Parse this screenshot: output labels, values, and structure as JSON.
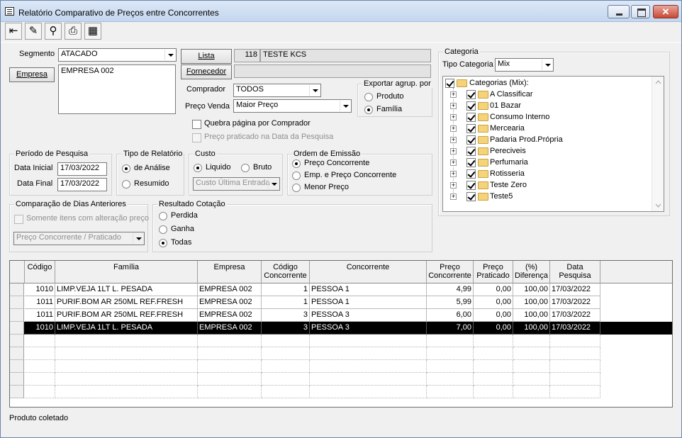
{
  "window": {
    "title": "Relatório Comparativo de Preços entre Concorrentes",
    "close_label": "✕"
  },
  "toolbar": {
    "items": [
      {
        "name": "exit-icon",
        "glyph": "⇤"
      },
      {
        "name": "eraser-icon",
        "glyph": "✎"
      },
      {
        "name": "binoculars-icon",
        "glyph": "⚲"
      },
      {
        "name": "printer-icon",
        "glyph": "⎙"
      },
      {
        "name": "export-grid-icon",
        "glyph": "▦"
      }
    ]
  },
  "filters": {
    "segmento_label": "Segmento",
    "segmento_value": "ATACADO",
    "empresa_button": "Empresa",
    "empresa_list": "EMPRESA 002",
    "lista_button": "Lista",
    "lista_code": "118",
    "lista_name": "TESTE KCS",
    "fornecedor_button": "Fornecedor",
    "fornecedor_value": "",
    "comprador_label": "Comprador",
    "comprador_value": "TODOS",
    "preco_venda_label": "Preço Venda",
    "preco_venda_value": "Maior Preço",
    "quebra_label": "Quebra página por Comprador",
    "preco_praticado_label": "Preço praticado na Data da Pesquisa"
  },
  "exportar": {
    "title": "Exportar agrup. por",
    "options": [
      "Produto",
      "Família"
    ],
    "selected": 1
  },
  "periodo": {
    "title": "Período de Pesquisa",
    "inicial_label": "Data Inicial",
    "inicial_value": "17/03/2022",
    "final_label": "Data Final",
    "final_value": "17/03/2022"
  },
  "tipo_relatorio": {
    "title": "Tipo de Relatório",
    "options": [
      "de Análise",
      "Resumido"
    ],
    "selected": 0
  },
  "custo": {
    "title": "Custo",
    "options": [
      "Liquido",
      "Bruto"
    ],
    "selected": 0,
    "select_value": "Custo Última Entrada"
  },
  "ordem": {
    "title": "Ordem de Emissão",
    "options": [
      "Preço Concorrente",
      "Emp. e Preço Concorrente",
      "Menor Preço"
    ],
    "selected": 0
  },
  "comparacao": {
    "title": "Comparação de Dias Anteriores",
    "check_label": "Somente itens com alteração preço",
    "select_value": "Preço Concorrente / Praticado"
  },
  "resultado": {
    "title": "Resultado Cotação",
    "options": [
      "Perdida",
      "Ganha",
      "Todas"
    ],
    "selected": 2
  },
  "categoria": {
    "title": "Categoria",
    "tipo_label": "Tipo Categoria",
    "tipo_value": "Mix",
    "root": "Categorias (Mix):",
    "items": [
      " A Classificar",
      "01 Bazar",
      "Consumo Interno",
      "Mercearia",
      "Padaria Prod.Própria",
      "Pereciveis",
      "Perfumaria",
      "Rotisseria",
      "Teste Zero",
      "Teste5"
    ]
  },
  "grid": {
    "headers": [
      "Código",
      "Família",
      "Empresa",
      "Código\nConcorrente",
      "Concorrente",
      "Preço\nConcorrente",
      "Preço\nPraticado",
      "(%)\nDiferença",
      "Data\nPesquisa"
    ],
    "rows": [
      [
        "1010",
        "LIMP.VEJA 1LT L. PESADA",
        "EMPRESA 002",
        "1",
        "PESSOA 1",
        "4,99",
        "0,00",
        "100,00",
        "17/03/2022"
      ],
      [
        "1011",
        "PURIF.BOM AR 250ML REF.FRESH",
        "EMPRESA 002",
        "1",
        "PESSOA 1",
        "5,99",
        "0,00",
        "100,00",
        "17/03/2022"
      ],
      [
        "1011",
        "PURIF.BOM AR 250ML REF.FRESH",
        "EMPRESA 002",
        "3",
        "PESSOA 3",
        "6,00",
        "0,00",
        "100,00",
        "17/03/2022"
      ],
      [
        "1010",
        "LIMP.VEJA 1LT L. PESADA",
        "EMPRESA 002",
        "3",
        "PESSOA 3",
        "7,00",
        "0,00",
        "100,00",
        "17/03/2022"
      ]
    ],
    "selected_row": 3
  },
  "status": {
    "text": "Produto coletado"
  }
}
